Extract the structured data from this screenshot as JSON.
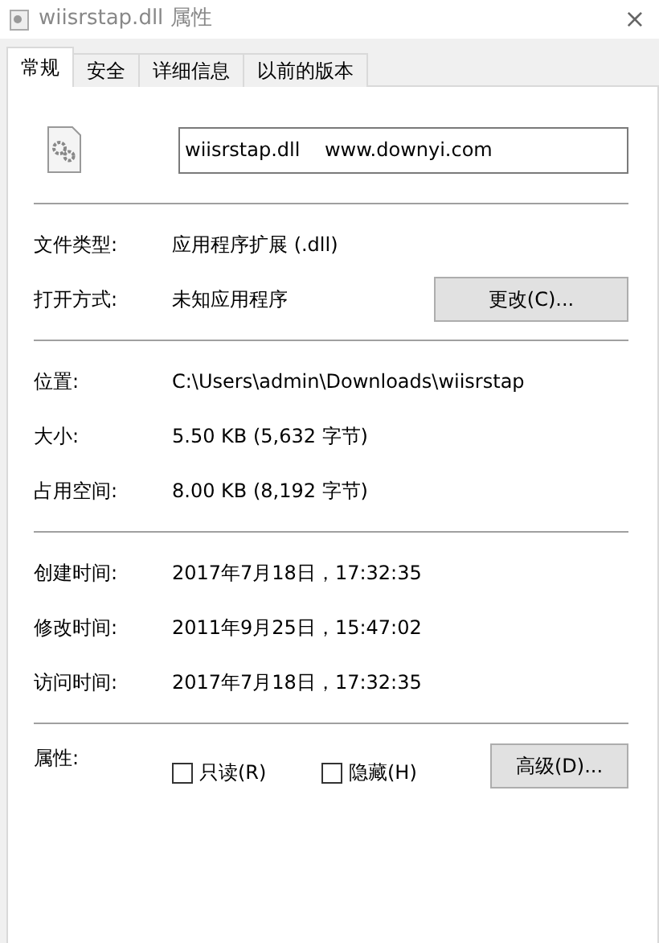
{
  "window": {
    "title": "wiisrstap.dll 属性",
    "close": "×"
  },
  "tabs": [
    {
      "label": "常规",
      "selected": true
    },
    {
      "label": "安全",
      "selected": false
    },
    {
      "label": "详细信息",
      "selected": false
    },
    {
      "label": "以前的版本",
      "selected": false
    }
  ],
  "file_name": {
    "value": "wiisrstap.dll    www.downyi.com"
  },
  "sections": [
    {
      "rows": [
        {
          "label": "文件类型:",
          "value": "应用程序扩展 (.dll)"
        },
        {
          "label": "打开方式:",
          "value": "未知应用程序",
          "button": "更改(C)..."
        }
      ]
    },
    {
      "rows": [
        {
          "label": "位置:",
          "value": "C:\\Users\\admin\\Downloads\\wiisrstap"
        },
        {
          "label": "大小:",
          "value": "5.50 KB (5,632 字节)"
        },
        {
          "label": "占用空间:",
          "value": "8.00 KB (8,192 字节)"
        }
      ]
    },
    {
      "rows": [
        {
          "label": "创建时间:",
          "value": "2017年7月18日，17:32:35"
        },
        {
          "label": "修改时间:",
          "value": "2011年9月25日，15:47:02"
        },
        {
          "label": "访问时间:",
          "value": "2017年7月18日，17:32:35"
        }
      ]
    }
  ],
  "attributes": {
    "label": "属性:",
    "checkboxes": [
      {
        "label": "只读(R)",
        "checked": false
      },
      {
        "label": "隐藏(H)",
        "checked": false
      }
    ],
    "button": "高级(D)..."
  }
}
